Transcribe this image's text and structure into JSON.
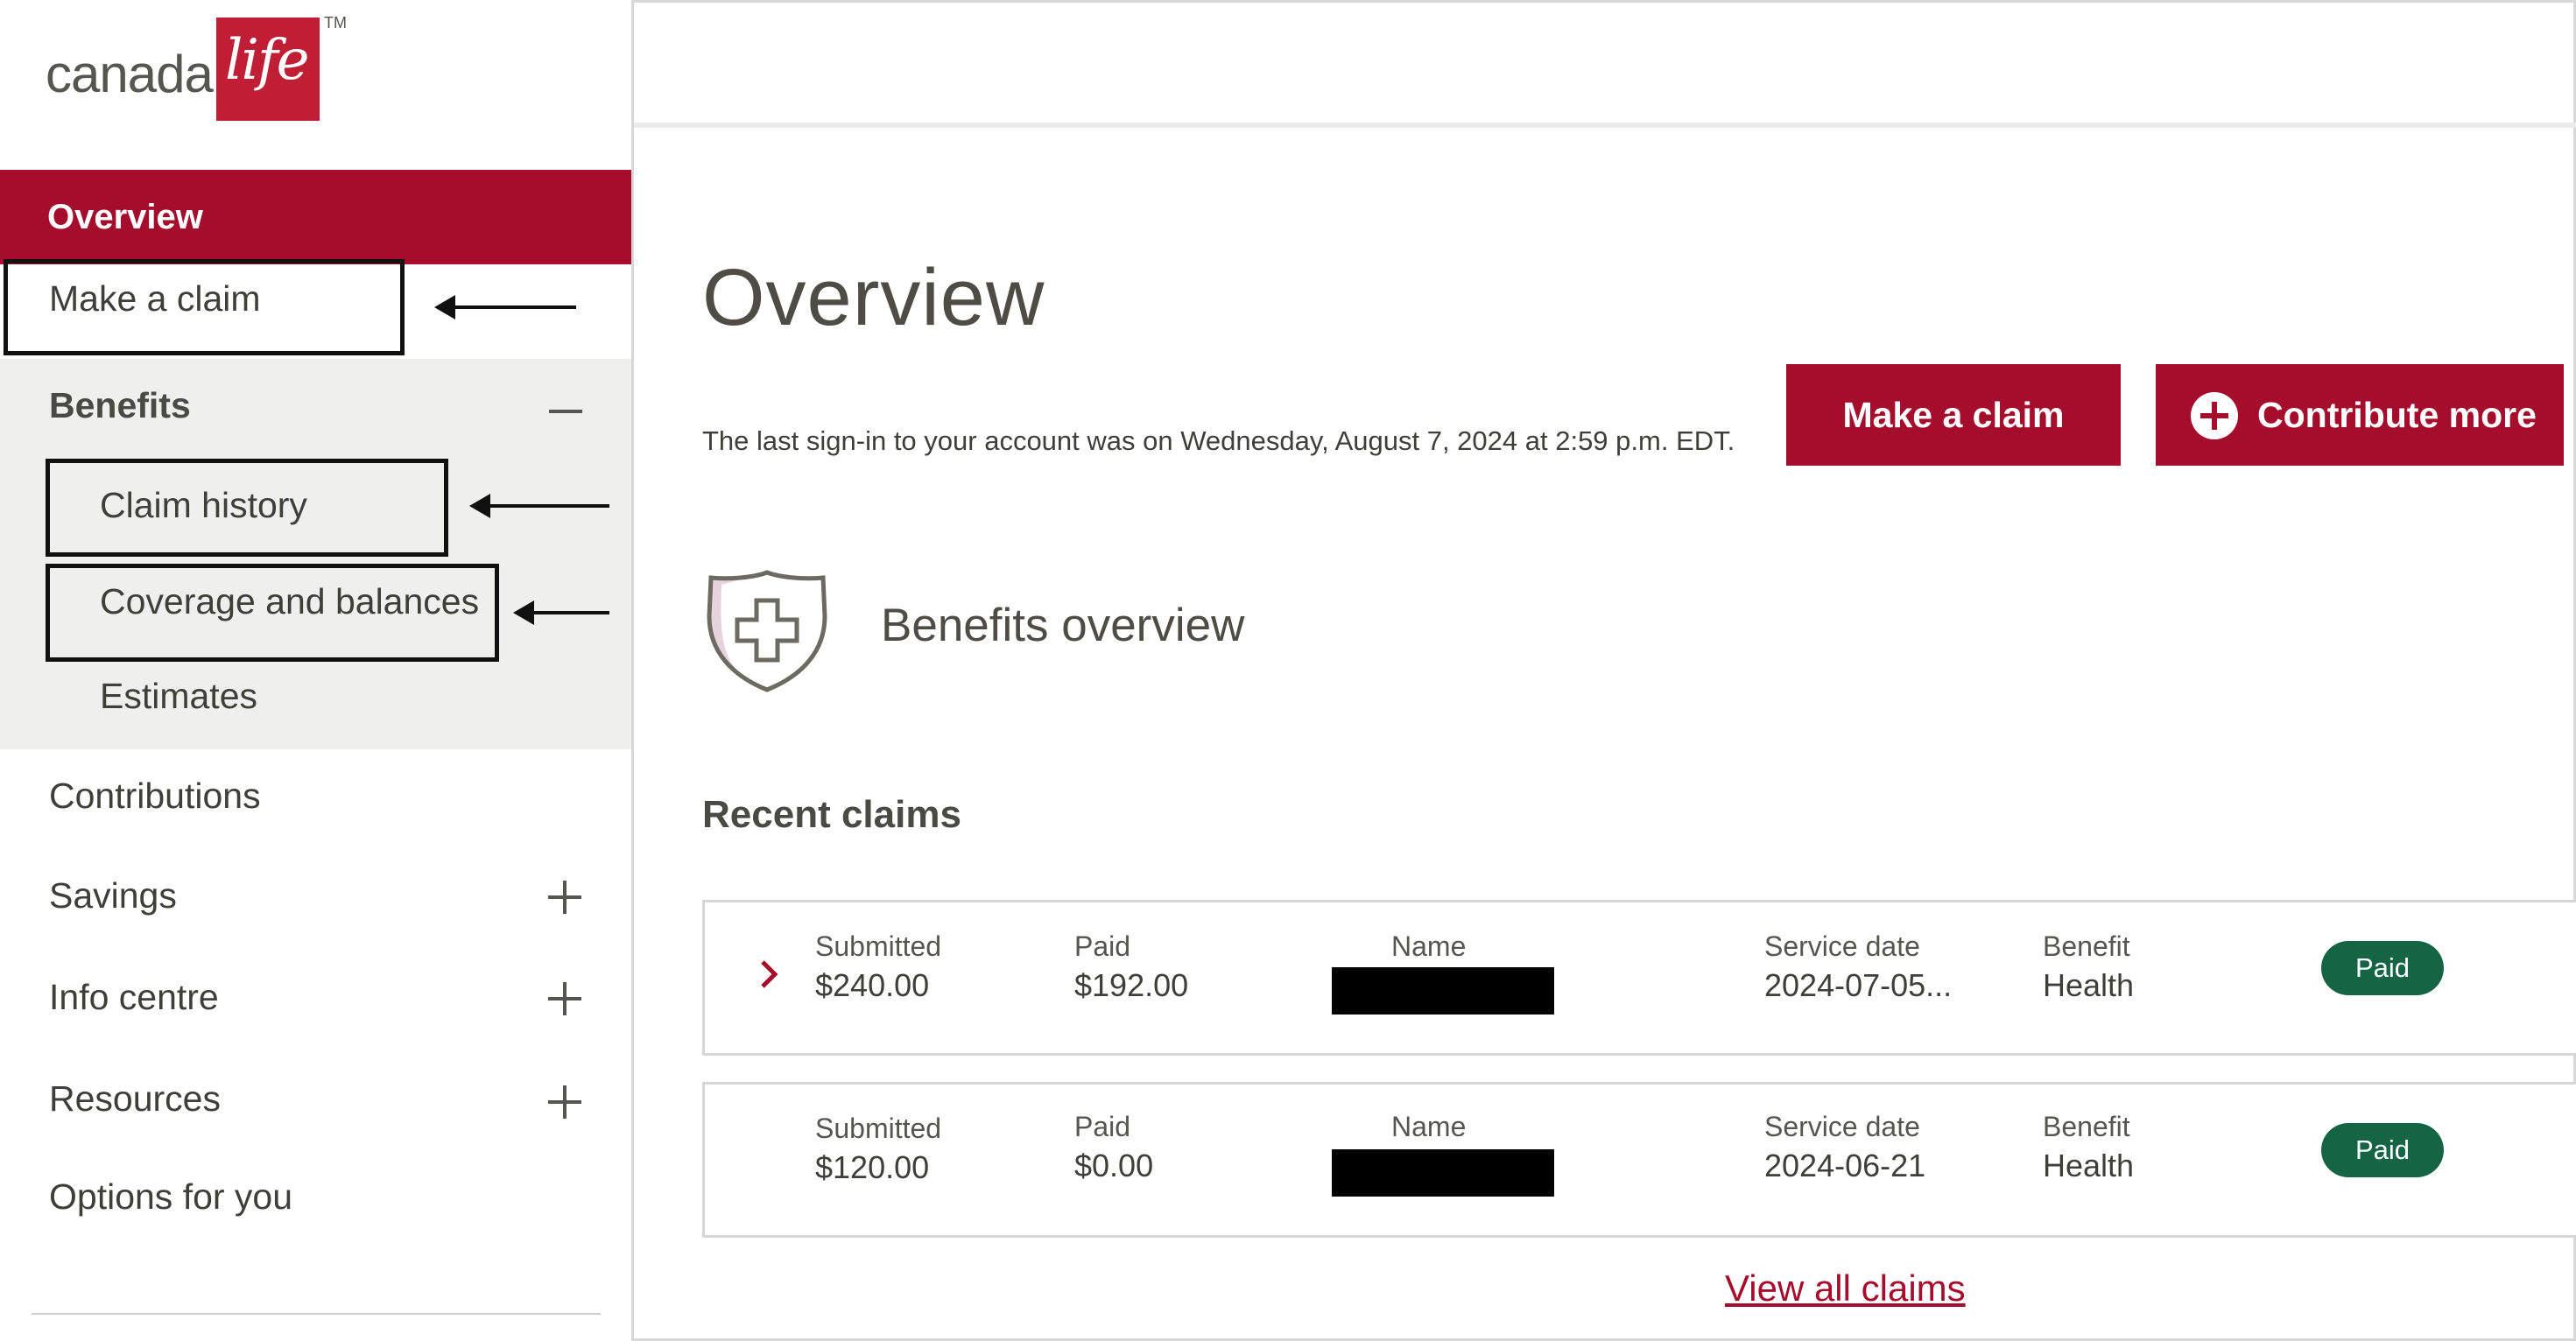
{
  "brand": {
    "logo_text": "canada",
    "logo_script": "life",
    "trademark": "TM",
    "accent": "#a50d2c",
    "logo_red": "#bf1e35"
  },
  "sidebar": {
    "active_item": "Overview",
    "make_claim": "Make a claim",
    "benefits": {
      "label": "Benefits",
      "expanded": true,
      "items": [
        "Claim history",
        "Coverage and balances",
        "Estimates"
      ]
    },
    "items": [
      {
        "label": "Contributions",
        "expandable": false
      },
      {
        "label": "Savings",
        "expandable": true
      },
      {
        "label": "Info centre",
        "expandable": true
      },
      {
        "label": "Resources",
        "expandable": true
      },
      {
        "label": "Options for you",
        "expandable": false
      }
    ]
  },
  "main": {
    "title": "Overview",
    "last_signin": "The last sign-in to your account was on Wednesday, August 7, 2024 at 2:59 p.m. EDT.",
    "buttons": {
      "make_claim": "Make a claim",
      "contribute_more": "Contribute more"
    },
    "benefits_overview": "Benefits overview",
    "recent_claims_title": "Recent claims",
    "labels": {
      "submitted": "Submitted",
      "paid": "Paid",
      "name": "Name",
      "service_date": "Service date",
      "benefit": "Benefit"
    },
    "claims": [
      {
        "submitted": "$240.00",
        "paid": "$192.00",
        "name": "[redacted]",
        "service_date": "2024-07-05...",
        "benefit": "Health",
        "status": "Paid",
        "expandable": true
      },
      {
        "submitted": "$120.00",
        "paid": "$0.00",
        "name": "[redacted]",
        "service_date": "2024-06-21",
        "benefit": "Health",
        "status": "Paid",
        "expandable": false
      }
    ],
    "view_all": "View all claims",
    "status_color": "#156545"
  }
}
